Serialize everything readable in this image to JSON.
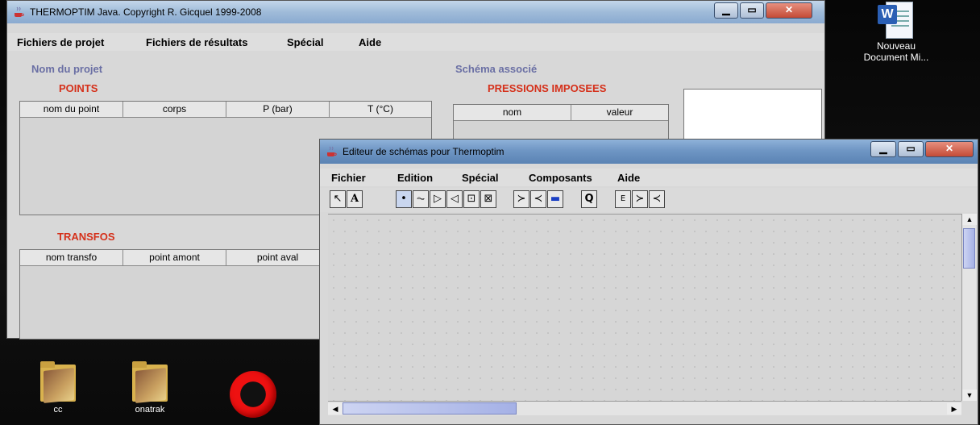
{
  "desktop": {
    "icons": [
      {
        "label": "cc"
      },
      {
        "label": "onatrak"
      },
      {
        "label": ""
      }
    ],
    "word_doc": {
      "label": "Nouveau Document Mi..."
    }
  },
  "main_window": {
    "title": "THERMOPTIM Java. Copyright R. Gicquel 1999-2008",
    "menu": [
      "Fichiers de projet",
      "Fichiers de résultats",
      "Spécial",
      "Aide"
    ],
    "project_name_label": "Nom du projet",
    "schema_label": "Schéma associé",
    "points": {
      "title": "POINTS",
      "columns": [
        "nom du point",
        "corps",
        "P (bar)",
        "T (°C)"
      ]
    },
    "pressions": {
      "title": "PRESSIONS IMPOSEES",
      "columns": [
        "nom",
        "valeur"
      ]
    },
    "transfos": {
      "title": "TRANSFOS",
      "columns": [
        "nom transfo",
        "point amont",
        "point aval"
      ]
    }
  },
  "editor_window": {
    "title": "Editeur de schémas pour Thermoptim",
    "menu": [
      "Fichier",
      "Edition",
      "Spécial",
      "Composants",
      "Aide"
    ],
    "tools": [
      {
        "name": "select-arrow-tool",
        "glyph": "↖"
      },
      {
        "name": "text-tool",
        "glyph": "A"
      },
      {
        "name": "point-tool",
        "glyph": "•"
      },
      {
        "name": "resistor-tool",
        "glyph": "⏦"
      },
      {
        "name": "compressor-tool",
        "glyph": "▷"
      },
      {
        "name": "turbine-tool",
        "glyph": "◁"
      },
      {
        "name": "combustion-tool",
        "glyph": "⊡"
      },
      {
        "name": "exchanger-tool",
        "glyph": "⊠"
      },
      {
        "name": "mixer-tool",
        "glyph": "≻"
      },
      {
        "name": "divider-tool",
        "glyph": "≺"
      },
      {
        "name": "pipe-tool",
        "glyph": "▬"
      },
      {
        "name": "q-tool",
        "glyph": "Q"
      },
      {
        "name": "external-e-tool",
        "glyph": "E"
      },
      {
        "name": "external-mixer-tool",
        "glyph": "≻"
      },
      {
        "name": "external-divider-tool",
        "glyph": "≺"
      }
    ]
  }
}
